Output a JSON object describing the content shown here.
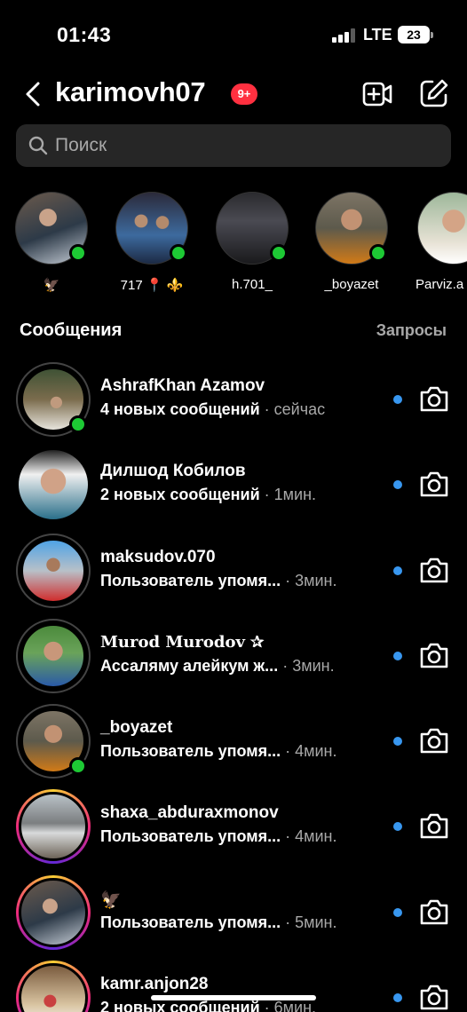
{
  "status_bar": {
    "time": "01:43",
    "network": "LTE",
    "battery": "23"
  },
  "header": {
    "username": "karimovh07",
    "badge": "9+"
  },
  "search": {
    "placeholder": "Поиск"
  },
  "stories": [
    {
      "label": "🦅",
      "online": true
    },
    {
      "label": "717 📍 ⚜️",
      "online": true
    },
    {
      "label": "h.701_",
      "online": true
    },
    {
      "label": "_boyazet",
      "online": true
    },
    {
      "label": "Parviz.a",
      "online": false
    }
  ],
  "section": {
    "title": "Сообщения",
    "requests": "Запросы"
  },
  "messages": [
    {
      "name": "AshrafKhan Azamov",
      "preview": "4 новых сообщений",
      "time": " · сейчас",
      "online": true
    },
    {
      "name": "Дилшод Кобилов",
      "preview": "2 новых сообщений",
      "time": " · 1мин.",
      "online": false
    },
    {
      "name": "maksudov.070",
      "preview": "Пользователь упомя...",
      "time": " · 3мин.",
      "online": false
    },
    {
      "name": "𝐌𝐮𝐫𝐨𝐝 𝐌𝐮𝐫𝐨𝐝𝐨𝐯 ✰",
      "preview": "Ассаляму алейкум ж...",
      "time": " · 3мин.",
      "online": false
    },
    {
      "name": "_boyazet",
      "preview": "Пользователь упомя...",
      "time": " · 4мин.",
      "online": true
    },
    {
      "name": "shaxa_abduraxmonov",
      "preview": "Пользователь упомя...",
      "time": " · 4мин.",
      "online": false
    },
    {
      "name": "🦅",
      "preview": "Пользователь упомя...",
      "time": " · 5мин.",
      "online": false
    },
    {
      "name": "kamr.anjon28",
      "preview": "2 новых сообщений",
      "time": " · 6мин.",
      "online": false
    }
  ],
  "colors": {
    "background": "#000000",
    "unread_dot": "#3897f0",
    "badge": "#ff3040",
    "online": "#1dc934"
  }
}
